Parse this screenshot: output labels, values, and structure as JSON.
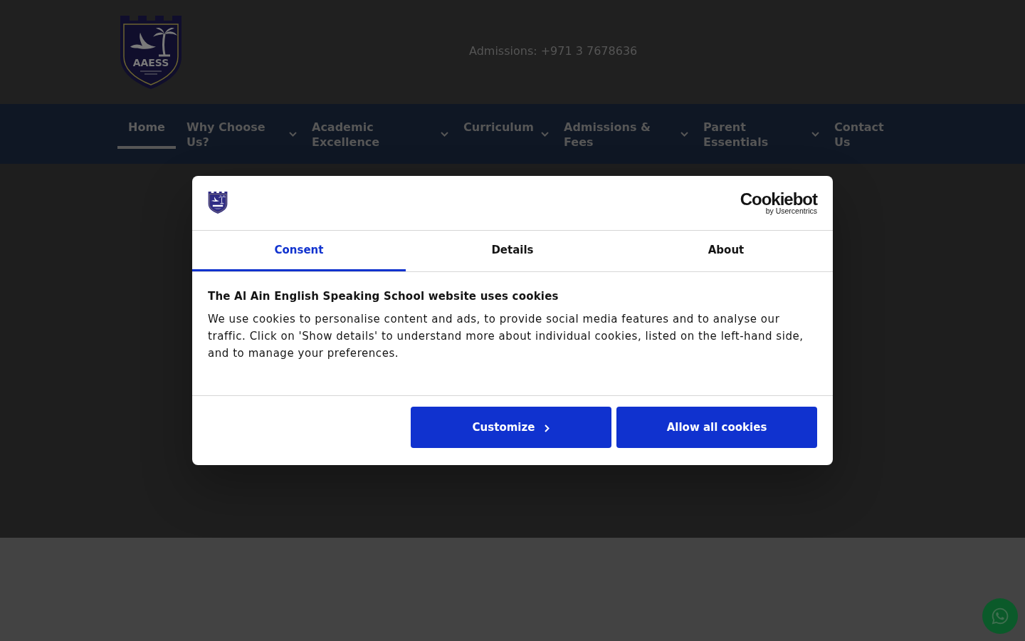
{
  "header": {
    "logo_text": "AAESS",
    "admissions": "Admissions: +971 3 7678636"
  },
  "nav": {
    "items": [
      {
        "label": "Home",
        "selected": true,
        "dropdown": false
      },
      {
        "label": "Why Choose Us?",
        "selected": false,
        "dropdown": true
      },
      {
        "label": "Academic Excellence",
        "selected": false,
        "dropdown": true
      },
      {
        "label": "Curriculum",
        "selected": false,
        "dropdown": true
      },
      {
        "label": "Admissions & Fees",
        "selected": false,
        "dropdown": true
      },
      {
        "label": "Parent Essentials",
        "selected": false,
        "dropdown": true
      },
      {
        "label": "Contact Us",
        "selected": false,
        "dropdown": false
      }
    ]
  },
  "cookie_dialog": {
    "brand": {
      "name": "Cookiebot",
      "tagline": "by Usercentrics"
    },
    "tabs": [
      {
        "label": "Consent",
        "selected": true
      },
      {
        "label": "Details",
        "selected": false
      },
      {
        "label": "About",
        "selected": false
      }
    ],
    "title": "The Al Ain English Speaking School website uses cookies",
    "text": "We use cookies to personalise content and ads, to provide social media features and to analyse our traffic. Click on 'Show details' to understand more about individual cookies, listed on the left-hand side, and to manage your preferences.",
    "buttons": [
      {
        "label": "Customize",
        "kind": "customize"
      },
      {
        "label": "Allow all cookies",
        "kind": "allow"
      }
    ]
  }
}
